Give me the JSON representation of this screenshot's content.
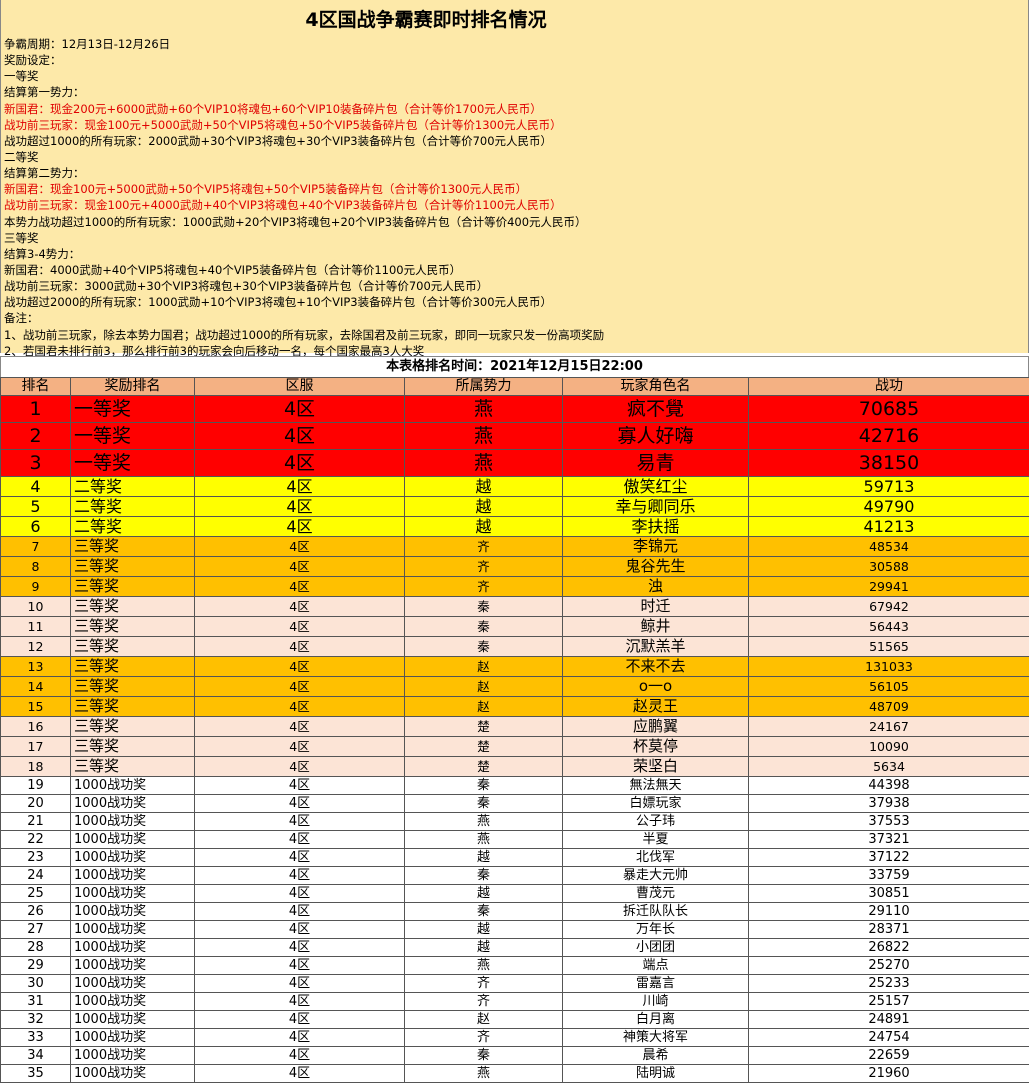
{
  "title": "4区国战争霸赛即时排名情况",
  "info_lines": [
    {
      "text": "争霸周期：12月13日-12月26日",
      "red": false
    },
    {
      "text": "奖励设定：",
      "red": false
    },
    {
      "text": "一等奖",
      "red": false
    },
    {
      "text": "结算第一势力：",
      "red": false
    },
    {
      "text": "新国君：现金200元+6000武勋+60个VIP10将魂包+60个VIP10装备碎片包（合计等价1700元人民币）",
      "red": true
    },
    {
      "text": "战功前三玩家：现金100元+5000武勋+50个VIP5将魂包+50个VIP5装备碎片包（合计等价1300元人民币）",
      "red": true
    },
    {
      "text": "战功超过1000的所有玩家：2000武勋+30个VIP3将魂包+30个VIP3装备碎片包（合计等价700元人民币）",
      "red": false
    },
    {
      "text": "二等奖",
      "red": false
    },
    {
      "text": "结算第二势力：",
      "red": false
    },
    {
      "text": "新国君：现金100元+5000武勋+50个VIP5将魂包+50个VIP5装备碎片包（合计等价1300元人民币）",
      "red": true
    },
    {
      "text": "战功前三玩家：现金100元+4000武勋+40个VIP3将魂包+40个VIP3装备碎片包（合计等价1100元人民币）",
      "red": true
    },
    {
      "text": "本势力战功超过1000的所有玩家：1000武勋+20个VIP3将魂包+20个VIP3装备碎片包（合计等价400元人民币）",
      "red": false
    },
    {
      "text": "三等奖",
      "red": false
    },
    {
      "text": "结算3-4势力：",
      "red": false
    },
    {
      "text": "新国君：4000武勋+40个VIP5将魂包+40个VIP5装备碎片包（合计等价1100元人民币）",
      "red": false
    },
    {
      "text": "战功前三玩家：3000武勋+30个VIP3将魂包+30个VIP3装备碎片包（合计等价700元人民币）",
      "red": false
    },
    {
      "text": "战功超过2000的所有玩家：1000武勋+10个VIP3将魂包+10个VIP3装备碎片包（合计等价300元人民币）",
      "red": false
    },
    {
      "text": "备注：",
      "red": false
    },
    {
      "text": "1、战功前三玩家，除去本势力国君；战功超过1000的所有玩家，去除国君及前三玩家，即同一玩家只发一份高项奖励",
      "red": false
    },
    {
      "text": "2、若国君未排行前3，那么排行前3的玩家会向后移动一名，每个国家最高3人大奖",
      "red": false
    }
  ],
  "timestamp": "本表格排名时间：2021年12月15日22:00",
  "columns": [
    "排名",
    "奖励排名",
    "区服",
    "所属势力",
    "玩家角色名",
    "战功"
  ],
  "rows": [
    {
      "rank": "1",
      "award": "一等奖",
      "server": "4区",
      "faction": "燕",
      "name": "疯不覺",
      "merit": "70685",
      "tier": "t1"
    },
    {
      "rank": "2",
      "award": "一等奖",
      "server": "4区",
      "faction": "燕",
      "name": "寡人好嗨",
      "merit": "42716",
      "tier": "t1"
    },
    {
      "rank": "3",
      "award": "一等奖",
      "server": "4区",
      "faction": "燕",
      "name": "易青",
      "merit": "38150",
      "tier": "t1"
    },
    {
      "rank": "4",
      "award": "二等奖",
      "server": "4区",
      "faction": "越",
      "name": "傲笑红尘",
      "merit": "59713",
      "tier": "t2"
    },
    {
      "rank": "5",
      "award": "二等奖",
      "server": "4区",
      "faction": "越",
      "name": "幸与卿同乐",
      "merit": "49790",
      "tier": "t2"
    },
    {
      "rank": "6",
      "award": "二等奖",
      "server": "4区",
      "faction": "越",
      "name": "李扶摇",
      "merit": "41213",
      "tier": "t2"
    },
    {
      "rank": "7",
      "award": "三等奖",
      "server": "4区",
      "faction": "齐",
      "name": "李锦元",
      "merit": "48534",
      "tier": "t3o"
    },
    {
      "rank": "8",
      "award": "三等奖",
      "server": "4区",
      "faction": "齐",
      "name": "鬼谷先生",
      "merit": "30588",
      "tier": "t3o"
    },
    {
      "rank": "9",
      "award": "三等奖",
      "server": "4区",
      "faction": "齐",
      "name": "浊",
      "merit": "29941",
      "tier": "t3o"
    },
    {
      "rank": "10",
      "award": "三等奖",
      "server": "4区",
      "faction": "秦",
      "name": "时迁",
      "merit": "67942",
      "tier": "t3p"
    },
    {
      "rank": "11",
      "award": "三等奖",
      "server": "4区",
      "faction": "秦",
      "name": "鲸井",
      "merit": "56443",
      "tier": "t3p"
    },
    {
      "rank": "12",
      "award": "三等奖",
      "server": "4区",
      "faction": "秦",
      "name": "沉默羔羊",
      "merit": "51565",
      "tier": "t3p"
    },
    {
      "rank": "13",
      "award": "三等奖",
      "server": "4区",
      "faction": "赵",
      "name": "不来不去",
      "merit": "131033",
      "tier": "t3o"
    },
    {
      "rank": "14",
      "award": "三等奖",
      "server": "4区",
      "faction": "赵",
      "name": "o一o",
      "merit": "56105",
      "tier": "t3o"
    },
    {
      "rank": "15",
      "award": "三等奖",
      "server": "4区",
      "faction": "赵",
      "name": "赵灵王",
      "merit": "48709",
      "tier": "t3o"
    },
    {
      "rank": "16",
      "award": "三等奖",
      "server": "4区",
      "faction": "楚",
      "name": "应鹏翼",
      "merit": "24167",
      "tier": "t3p"
    },
    {
      "rank": "17",
      "award": "三等奖",
      "server": "4区",
      "faction": "楚",
      "name": "杯莫停",
      "merit": "10090",
      "tier": "t3p"
    },
    {
      "rank": "18",
      "award": "三等奖",
      "server": "4区",
      "faction": "楚",
      "name": "荣坚白",
      "merit": "5634",
      "tier": "t3p"
    },
    {
      "rank": "19",
      "award": "1000战功奖",
      "server": "4区",
      "faction": "秦",
      "name": "無法無天",
      "merit": "44398",
      "tier": "t4"
    },
    {
      "rank": "20",
      "award": "1000战功奖",
      "server": "4区",
      "faction": "秦",
      "name": "白嫖玩家",
      "merit": "37938",
      "tier": "t4"
    },
    {
      "rank": "21",
      "award": "1000战功奖",
      "server": "4区",
      "faction": "燕",
      "name": "公子玮",
      "merit": "37553",
      "tier": "t4"
    },
    {
      "rank": "22",
      "award": "1000战功奖",
      "server": "4区",
      "faction": "燕",
      "name": "半夏",
      "merit": "37321",
      "tier": "t4"
    },
    {
      "rank": "23",
      "award": "1000战功奖",
      "server": "4区",
      "faction": "越",
      "name": "北伐军",
      "merit": "37122",
      "tier": "t4"
    },
    {
      "rank": "24",
      "award": "1000战功奖",
      "server": "4区",
      "faction": "秦",
      "name": "暴走大元帅",
      "merit": "33759",
      "tier": "t4"
    },
    {
      "rank": "25",
      "award": "1000战功奖",
      "server": "4区",
      "faction": "越",
      "name": "曹茂元",
      "merit": "30851",
      "tier": "t4"
    },
    {
      "rank": "26",
      "award": "1000战功奖",
      "server": "4区",
      "faction": "秦",
      "name": "拆迁队队长",
      "merit": "29110",
      "tier": "t4"
    },
    {
      "rank": "27",
      "award": "1000战功奖",
      "server": "4区",
      "faction": "越",
      "name": "万年长",
      "merit": "28371",
      "tier": "t4"
    },
    {
      "rank": "28",
      "award": "1000战功奖",
      "server": "4区",
      "faction": "越",
      "name": "小团团",
      "merit": "26822",
      "tier": "t4"
    },
    {
      "rank": "29",
      "award": "1000战功奖",
      "server": "4区",
      "faction": "燕",
      "name": "端点",
      "merit": "25270",
      "tier": "t4"
    },
    {
      "rank": "30",
      "award": "1000战功奖",
      "server": "4区",
      "faction": "齐",
      "name": "雷嘉言",
      "merit": "25233",
      "tier": "t4"
    },
    {
      "rank": "31",
      "award": "1000战功奖",
      "server": "4区",
      "faction": "齐",
      "name": "川崎",
      "merit": "25157",
      "tier": "t4"
    },
    {
      "rank": "32",
      "award": "1000战功奖",
      "server": "4区",
      "faction": "赵",
      "name": "白月离",
      "merit": "24891",
      "tier": "t4"
    },
    {
      "rank": "33",
      "award": "1000战功奖",
      "server": "4区",
      "faction": "齐",
      "name": "神策大将军",
      "merit": "24754",
      "tier": "t4"
    },
    {
      "rank": "34",
      "award": "1000战功奖",
      "server": "4区",
      "faction": "秦",
      "name": "晨希",
      "merit": "22659",
      "tier": "t4"
    },
    {
      "rank": "35",
      "award": "1000战功奖",
      "server": "4区",
      "faction": "燕",
      "name": "陆明诚",
      "merit": "21960",
      "tier": "t4"
    }
  ]
}
